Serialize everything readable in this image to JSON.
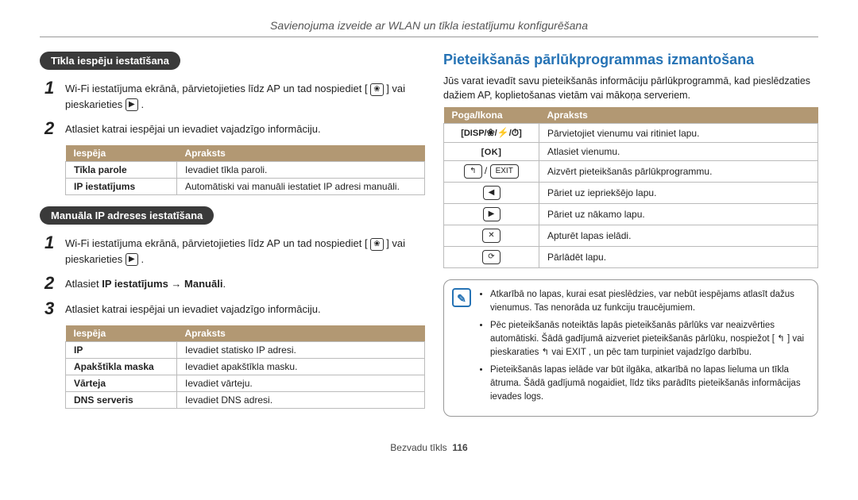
{
  "header": "Savienojuma izveide ar WLAN un tīkla iestatījumu konfigurēšana",
  "left": {
    "pill1": "Tīkla iespēju iestatīšana",
    "step1": "Wi-Fi iestatījuma ekrānā, pārvietojieties līdz AP un tad nospiediet [ ",
    "step1b": " ] vai pieskarieties ",
    "step1b2": " .",
    "step2": "Atlasiet katrai iespējai un ievadiet vajadzīgo informāciju.",
    "table1": {
      "h1": "Iespēja",
      "h2": "Apraksts",
      "rows": [
        [
          "Tīkla parole",
          "Ievadiet tīkla paroli."
        ],
        [
          "IP iestatījums",
          "Automātiski vai manuāli iestatiet IP adresi manuāli."
        ]
      ]
    },
    "pill2": "Manuāla IP adreses iestatīšana",
    "step_m1": "Wi-Fi iestatījuma ekrānā, pārvietojieties līdz AP un tad nospiediet [ ",
    "step_m1b": " ] vai pieskarieties ",
    "step_m1b2": " .",
    "step_m2a": "Atlasiet ",
    "step_m2b": "IP iestatījums → Manuāli",
    "step_m2c": ".",
    "step_m3": "Atlasiet katrai iespējai un ievadiet vajadzīgo informāciju.",
    "table2": {
      "h1": "Iespēja",
      "h2": "Apraksts",
      "rows": [
        [
          "IP",
          "Ievadiet statisko IP adresi."
        ],
        [
          "Apakštīkla maska",
          "Ievadiet apakštīkla masku."
        ],
        [
          "Vārteja",
          "Ievadiet vārteju."
        ],
        [
          "DNS serveris",
          "Ievadiet DNS adresi."
        ]
      ]
    }
  },
  "right": {
    "title": "Pieteikšanās pārlūkprogrammas izmantošana",
    "intro": "Jūs varat ievadīt savu pieteikšanās informāciju pārlūkprogrammā, kad pieslēdzaties dažiem AP, koplietošanas vietām vai mākoņa serveriem.",
    "table": {
      "h1": "Poga/Ikona",
      "h2": "Apraksts",
      "rows": [
        {
          "icon": "disp",
          "desc": "Pārvietojiet vienumu vai ritiniet lapu."
        },
        {
          "icon": "ok",
          "desc": "Atlasiet vienumu."
        },
        {
          "icon": "exit",
          "desc": "Aizvērt pieteikšanās pārlūkprogrammu."
        },
        {
          "icon": "left",
          "desc": "Pāriet uz iepriekšējo lapu."
        },
        {
          "icon": "right",
          "desc": "Pāriet uz nākamo lapu."
        },
        {
          "icon": "x",
          "desc": "Apturēt lapas ielādi."
        },
        {
          "icon": "reload",
          "desc": "Pārlādēt lapu."
        }
      ]
    },
    "notes": [
      "Atkarībā no lapas, kurai esat pieslēdzies, var nebūt iespējams atlasīt dažus vienumus. Tas nenorāda uz funkciju traucējumiem.",
      "Pēc pieteikšanās noteiktās lapās pieteikšanās pārlūks var neaizvērties automātiski. Šādā gadījumā aizveriet pieteikšanās pārlūku, nospiežot [ ↰ ] vai pieskaraties ↰ vai EXIT , un pēc tam turpiniet vajadzīgo darbību.",
      "Pieteikšanās lapas ielāde var būt ilgāka, atkarībā no lapas lieluma un tīkla ātruma. Šādā gadījumā nogaidiet, līdz tiks parādīts pieteikšanās informācijas ievades logs."
    ]
  },
  "footer": {
    "label": "Bezvadu tīkls",
    "page": "116"
  }
}
